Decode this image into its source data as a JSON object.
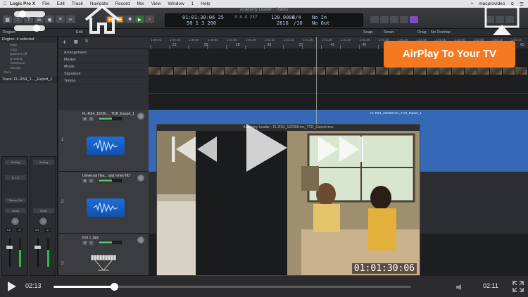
{
  "menubar": {
    "app": "Logic Pro X",
    "items": [
      "File",
      "Edit",
      "Track",
      "Navigate",
      "Record",
      "Mix",
      "View",
      "Window",
      "1",
      "Help"
    ],
    "user": "macprovideo"
  },
  "controlbar": {
    "window_title": "Academy Leader - Tracks",
    "lcd": {
      "smpte": "01:01:30:06 25",
      "smpte_sub": "50 1 3 200",
      "bars": "3 4 4 237",
      "bars_sub": "",
      "tempo": "120.0000",
      "tempo_sub": "2616",
      "signature": "4/4",
      "division": "/16",
      "in": "No In",
      "out": "No Out"
    }
  },
  "toolbar2": {
    "region": "Region:",
    "edit": "Edit",
    "snap_label": "Snap:",
    "snap_value": "Smart",
    "drag_label": "Drag:",
    "drag_value": "No Overlap"
  },
  "inspector": {
    "header": "Region: 4 selected",
    "rows": [
      "Mute",
      "Loop",
      "Quantize  off",
      "Q-Swing",
      "Transpose",
      "Velocity"
    ],
    "more": "More",
    "track": "Track: FL-RS4_1..._Export_1",
    "strip_left": {
      "setting": "Setting",
      "io": "In 1-2",
      "out": "Stereo Out",
      "mode": "Read",
      "vol": "0.0",
      "pan": "-17"
    },
    "strip_right": {
      "setting": "Setting",
      "mode": "Read",
      "vol": "0.0",
      "pan": "-17"
    }
  },
  "globals": [
    "Arrangement",
    "Marker",
    "Movie",
    "Signature",
    "Tempo"
  ],
  "tracks": [
    {
      "num": "1",
      "name": "FL-RS4_10230..._TCR_Export_1"
    },
    {
      "num": "2",
      "name": "Universal Hea... and remix-HD"
    },
    {
      "num": "3",
      "name": "Inst 1_bgs"
    }
  ],
  "ruler": {
    "ticks": [
      "1:00:40",
      "1:00:45",
      "1:00:50",
      "1:00:55",
      "1:01:00",
      "1:01:05",
      "1:01:10",
      "1:01:15",
      "1:01:20",
      "1:01:25",
      "1:01:30",
      "1:01:35",
      "1:01:40",
      "1:01:45",
      "1:01:50",
      "1:01:55",
      "1:02:00",
      "1:02:05",
      "1:02:10",
      "1:02:15"
    ],
    "bars": [
      "21",
      "25",
      "29",
      "33",
      "37",
      "41",
      "45",
      "49",
      "53",
      "57",
      "61",
      "65"
    ]
  },
  "region1": {
    "name": "FL-RS4_102308-mx_TCR_Export_1"
  },
  "viewer": {
    "title": "Academy Leader - FL-RS4_102308-mx_TCR_Export.mov",
    "timecode": "01:01:30:06"
  },
  "airplay": {
    "label": "AirPlay To Your TV"
  },
  "player": {
    "current": "02:13",
    "duration": "02:11",
    "progress": 0.17
  },
  "colors": {
    "accent": "#f47920",
    "region": "#3568b5",
    "meter": "#2fb84a"
  },
  "icons": [
    "apple-icon",
    "play-icon",
    "rewind-icon",
    "fast-forward-icon",
    "home-icon",
    "airplay-icon",
    "volume-icon",
    "fullscreen-icon"
  ]
}
